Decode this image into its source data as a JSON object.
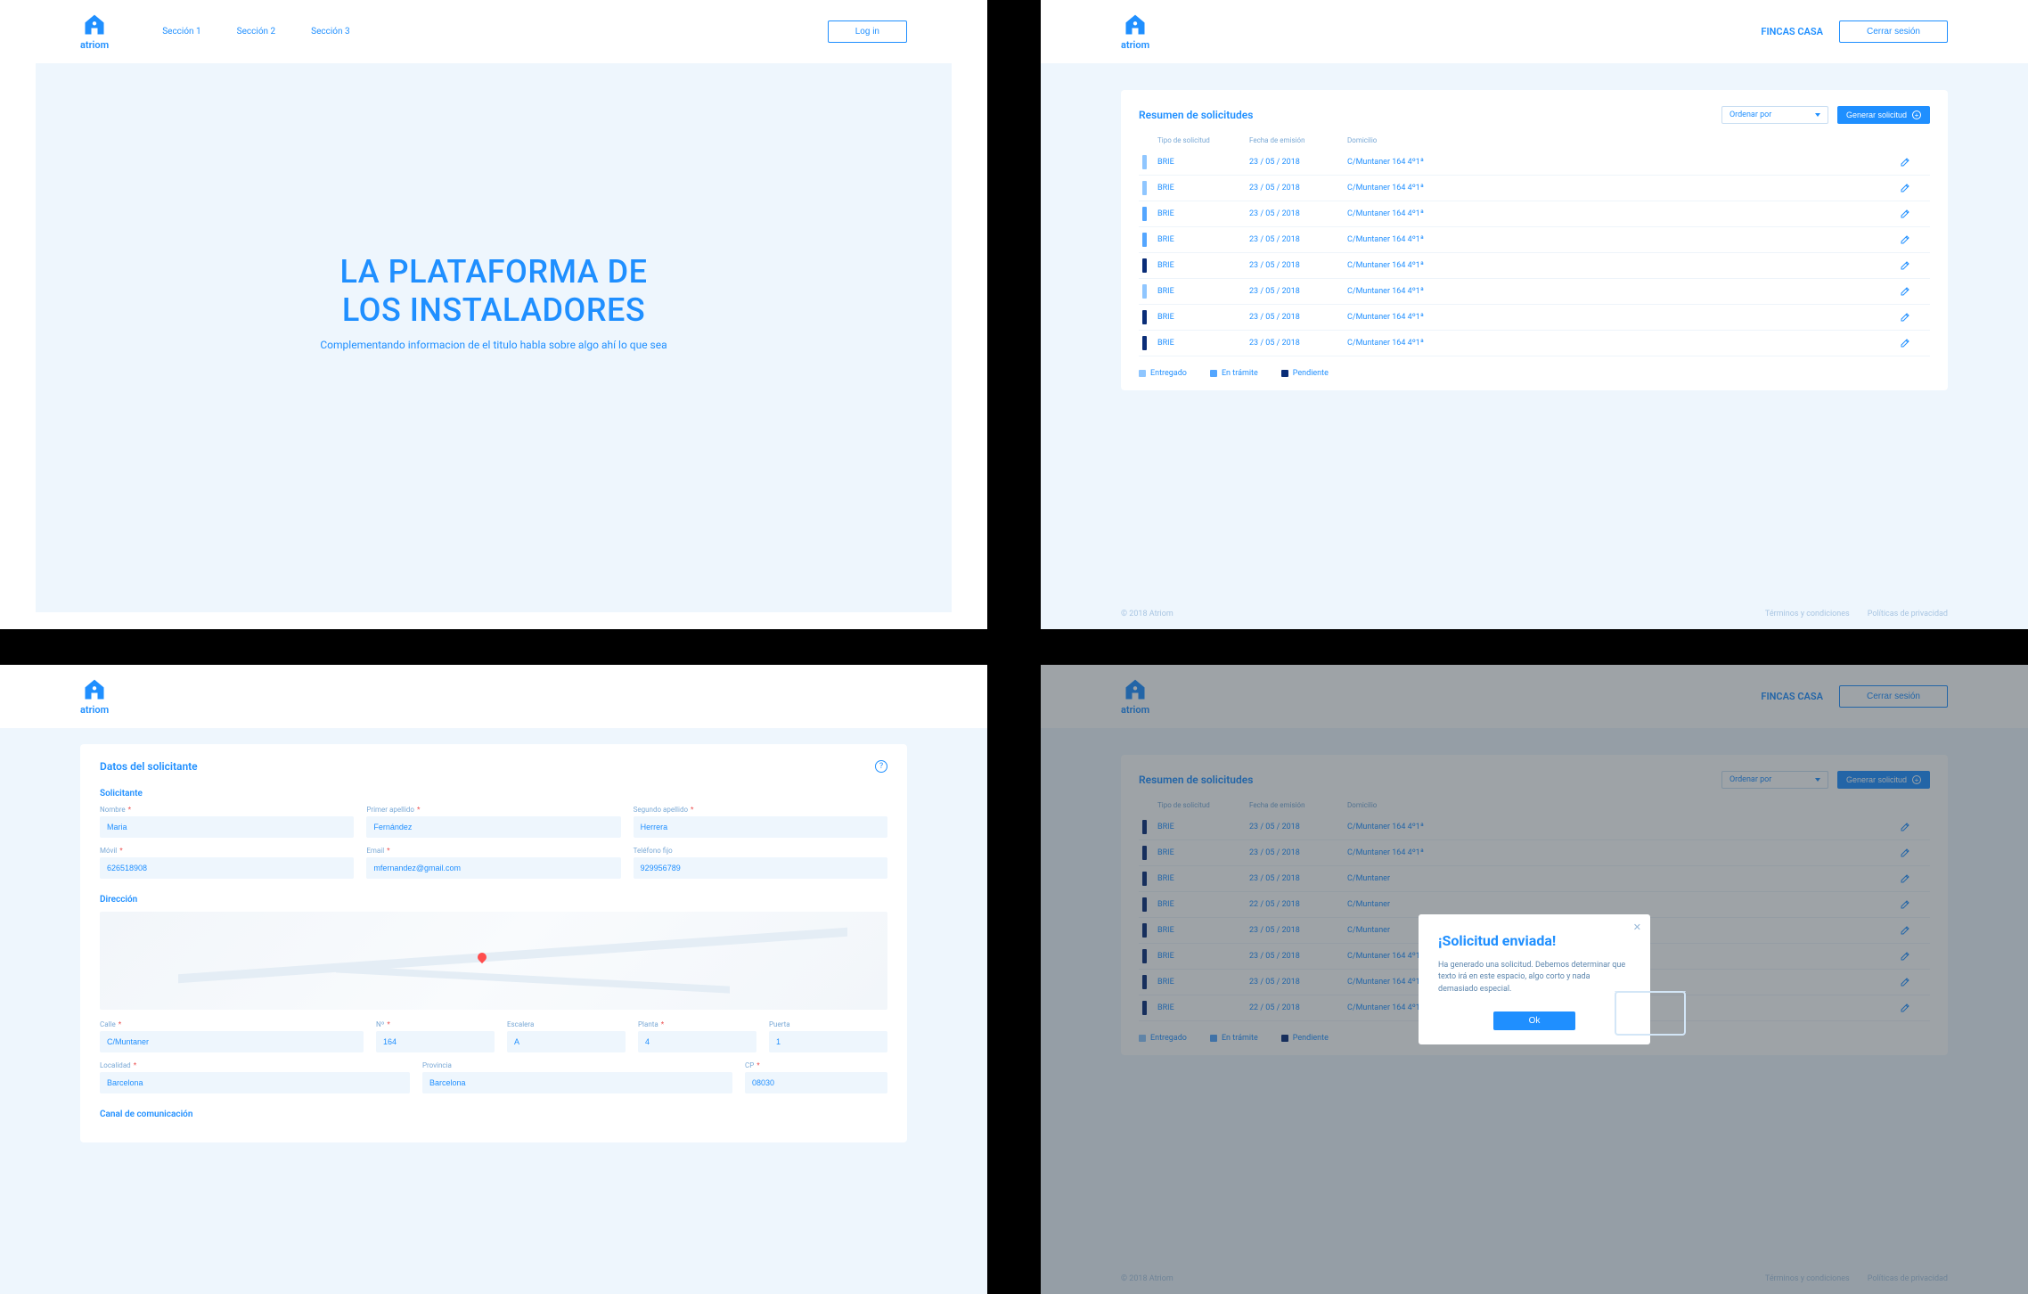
{
  "brand": "atriom",
  "screen1": {
    "nav": [
      "Sección 1",
      "Sección 2",
      "Sección 3"
    ],
    "login": "Log in",
    "hero_line1": "LA PLATAFORMA DE",
    "hero_line2": "LOS INSTALADORES",
    "hero_sub": "Complementando informacion de el titulo habla sobre algo ahí lo que sea"
  },
  "screen2": {
    "account": "FINCAS CASA",
    "logout": "Cerrar sesión",
    "card_title": "Resumen de solicitudes",
    "sort_label": "Ordenar por",
    "generate": "Generar solicitud",
    "cols": {
      "type": "Tipo de solicitud",
      "date": "Fecha de emisión",
      "addr": "Domicilio"
    },
    "rows": [
      {
        "status": "entregado",
        "type": "BRIE",
        "date": "23 / 05 / 2018",
        "addr": "C/Muntaner 164 4º1ª"
      },
      {
        "status": "entregado",
        "type": "BRIE",
        "date": "23 / 05 / 2018",
        "addr": "C/Muntaner 164 4º1ª"
      },
      {
        "status": "tramite",
        "type": "BRIE",
        "date": "23 / 05 / 2018",
        "addr": "C/Muntaner 164 4º1ª"
      },
      {
        "status": "tramite",
        "type": "BRIE",
        "date": "23 / 05 / 2018",
        "addr": "C/Muntaner 164 4º1ª"
      },
      {
        "status": "pendiente",
        "type": "BRIE",
        "date": "23 / 05 / 2018",
        "addr": "C/Muntaner 164 4º1ª"
      },
      {
        "status": "entregado",
        "type": "BRIE",
        "date": "23 / 05 / 2018",
        "addr": "C/Muntaner 164 4º1ª"
      },
      {
        "status": "pendiente",
        "type": "BRIE",
        "date": "23 / 05 / 2018",
        "addr": "C/Muntaner 164 4º1ª"
      },
      {
        "status": "pendiente",
        "type": "BRIE",
        "date": "23 / 05 / 2018",
        "addr": "C/Muntaner 164 4º1ª"
      }
    ],
    "legend": {
      "entregado": "Entregado",
      "tramite": "En trámite",
      "pendiente": "Pendiente"
    },
    "footer": {
      "copy": "© 2018 Atriom",
      "terms": "Términos y condiciones",
      "privacy": "Políticas de privacidad"
    }
  },
  "screen3": {
    "title": "Datos del solicitante",
    "solicitante": "Solicitante",
    "direccion": "Dirección",
    "canal": "Canal de comunicación",
    "fields": {
      "nombre": {
        "label": "Nombre",
        "req": true,
        "value": "Maria"
      },
      "primer": {
        "label": "Primer apellido",
        "req": true,
        "value": "Fernández"
      },
      "segundo": {
        "label": "Segundo apellido",
        "req": true,
        "value": "Herrera"
      },
      "movil": {
        "label": "Móvil",
        "req": true,
        "value": "626518908"
      },
      "email": {
        "label": "Email",
        "req": true,
        "value": "mfernandez@gmail.com"
      },
      "telfijo": {
        "label": "Teléfono fijo",
        "req": false,
        "value": "929956789"
      },
      "calle": {
        "label": "Calle",
        "req": true,
        "value": "C/Muntaner"
      },
      "n": {
        "label": "Nº",
        "req": true,
        "value": "164"
      },
      "escalera": {
        "label": "Escalera",
        "req": false,
        "value": "A"
      },
      "planta": {
        "label": "Planta",
        "req": true,
        "value": "4"
      },
      "puerta": {
        "label": "Puerta",
        "req": false,
        "value": "1"
      },
      "localidad": {
        "label": "Localidad",
        "req": true,
        "value": "Barcelona"
      },
      "provincia": {
        "label": "Provincia",
        "req": false,
        "value": "Barcelona"
      },
      "cp": {
        "label": "CP",
        "req": true,
        "value": "08030"
      }
    }
  },
  "screen4": {
    "account": "FINCAS CASA",
    "logout": "Cerrar sesión",
    "card_title": "Resumen de solicitudes",
    "sort_label": "Ordenar por",
    "generate": "Generar solicitud",
    "cols": {
      "type": "Tipo de solicitud",
      "date": "Fecha de emisión",
      "addr": "Domicilio"
    },
    "rows": [
      {
        "status": "pendiente",
        "type": "BRIE",
        "date": "23 / 05 / 2018",
        "addr": "C/Muntaner 164 4º1ª"
      },
      {
        "status": "pendiente",
        "type": "BRIE",
        "date": "23 / 05 / 2018",
        "addr": "C/Muntaner 164 4º1ª"
      },
      {
        "status": "pendiente",
        "type": "BRIE",
        "date": "23 / 05 / 2018",
        "addr": "C/Muntaner"
      },
      {
        "status": "pendiente",
        "type": "BRIE",
        "date": "22 / 05 / 2018",
        "addr": "C/Muntaner"
      },
      {
        "status": "pendiente",
        "type": "BRIE",
        "date": "23 / 05 / 2018",
        "addr": "C/Muntaner"
      },
      {
        "status": "pendiente",
        "type": "BRIE",
        "date": "23 / 05 / 2018",
        "addr": "C/Muntaner 164 4º1ª"
      },
      {
        "status": "pendiente",
        "type": "BRIE",
        "date": "23 / 05 / 2018",
        "addr": "C/Muntaner 164 4º1ª"
      },
      {
        "status": "pendiente",
        "type": "BRIE",
        "date": "22 / 05 / 2018",
        "addr": "C/Muntaner 164 4º1ª"
      }
    ],
    "legend": {
      "entregado": "Entregado",
      "tramite": "En trámite",
      "pendiente": "Pendiente"
    },
    "modal": {
      "title": "¡Solicitud enviada!",
      "body": "Ha generado una solicitud. Debemos determinar que texto irá en este espacio, algo corto y nada demasiado especial.",
      "ok": "Ok"
    },
    "footer": {
      "copy": "© 2018 Atriom",
      "terms": "Términos y condiciones",
      "privacy": "Políticas de privacidad"
    }
  }
}
